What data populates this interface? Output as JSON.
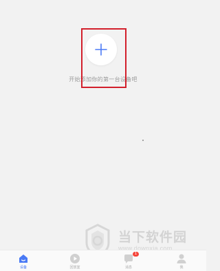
{
  "main": {
    "hint_text": "开始添加你的第一台设备吧"
  },
  "watermark": {
    "title": "当下软件园",
    "url": "www.downxia.com"
  },
  "tab_bar": {
    "tabs": [
      {
        "label": "设备",
        "active": true,
        "icon": "home-icon"
      },
      {
        "label": "回放室",
        "active": false,
        "icon": "playback-icon"
      },
      {
        "label": "消息",
        "active": false,
        "icon": "message-icon",
        "badge": "1"
      },
      {
        "label": "我",
        "active": false,
        "icon": "profile-icon"
      }
    ]
  },
  "colors": {
    "accent": "#4a7af5",
    "highlight": "#d21f2b",
    "badge": "#f5443a",
    "background": "#f2f2f2"
  }
}
